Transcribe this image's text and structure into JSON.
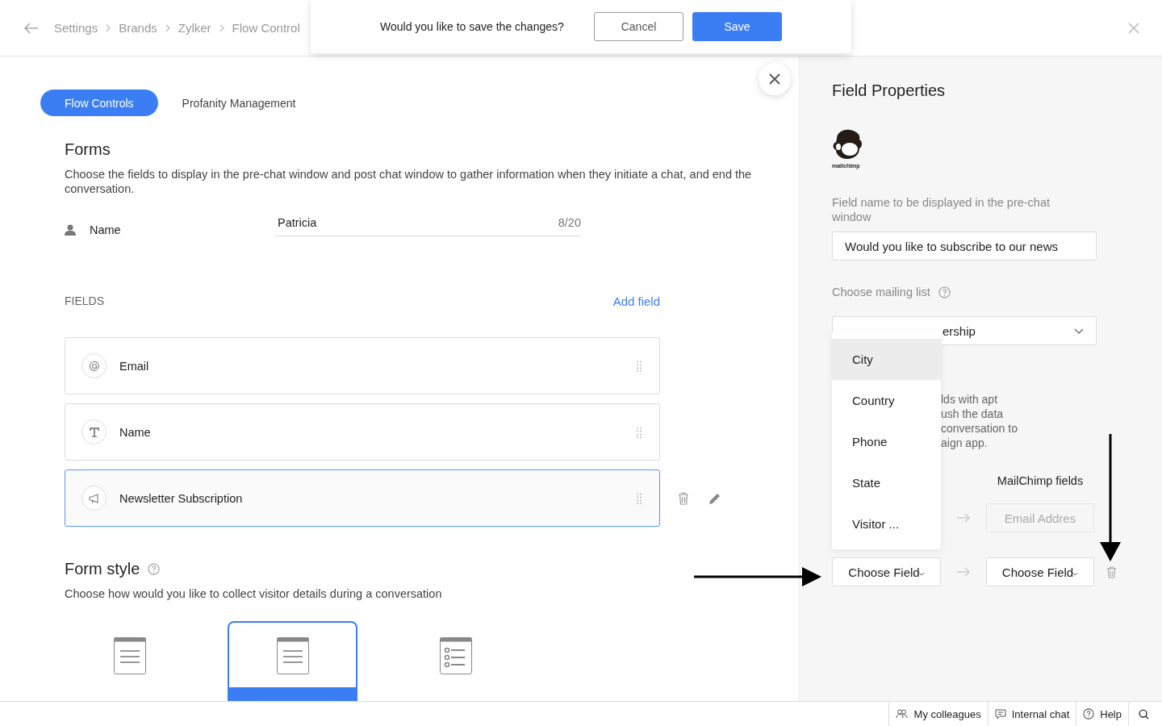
{
  "breadcrumb": [
    "Settings",
    "Brands",
    "Zylker",
    "Flow Control"
  ],
  "confirm": {
    "message": "Would you like to save the changes?",
    "buttons": [
      {
        "label": "Cancel",
        "kind": "secondary"
      },
      {
        "label": "Save",
        "kind": "primary"
      }
    ]
  },
  "tabs": [
    {
      "label": "Flow Controls",
      "selected": true
    },
    {
      "label": "Profanity Management",
      "selected": false
    }
  ],
  "forms": {
    "title": "Forms",
    "description": "Choose the fields to display in the pre-chat window and post chat window to gather information when they initiate a chat, and end the conversation.",
    "name_field": {
      "label": "Name",
      "value": "Patricia",
      "counter": "8/20"
    }
  },
  "fields": {
    "heading": "FIELDS",
    "add_link": "Add field",
    "items": [
      {
        "label": "Email",
        "kind": "email",
        "selected": false
      },
      {
        "label": "Name",
        "kind": "text",
        "selected": false
      },
      {
        "label": "Newsletter Subscription",
        "kind": "newsletter",
        "selected": true
      }
    ]
  },
  "form_style": {
    "title": "Form style",
    "description": "Choose how would you like to collect visitor details during a conversation",
    "options": [
      {
        "kind": "inline",
        "selected": false
      },
      {
        "kind": "conversation",
        "selected": true
      },
      {
        "kind": "traditional",
        "selected": false
      }
    ]
  },
  "field_properties": {
    "title": "Field Properties",
    "logo_caption": "mailchimp",
    "name_label": "Field name to be displayed in the pre-chat window",
    "name_value": "Would you like to subscribe to our news",
    "mailing_label": "Choose mailing list",
    "mailing_value": "ership",
    "dropdown": [
      {
        "label": "City",
        "selected": true
      },
      {
        "label": "Country",
        "selected": false
      },
      {
        "label": "Phone",
        "selected": false
      },
      {
        "label": "State",
        "selected": false
      },
      {
        "label": "Visitor ...",
        "selected": false
      }
    ],
    "description_lines": [
      "lds with apt",
      "ush the data",
      "conversation to",
      "aign app."
    ],
    "mapping": {
      "column_header": "MailChimp fields",
      "rows": [
        {
          "right": "Email Addres",
          "disabled": true
        },
        {
          "left": "Choose Field",
          "right": "Choose Field",
          "disabled": false
        }
      ]
    }
  },
  "status_bar": [
    "My colleagues",
    "Internal chat",
    "Help"
  ]
}
